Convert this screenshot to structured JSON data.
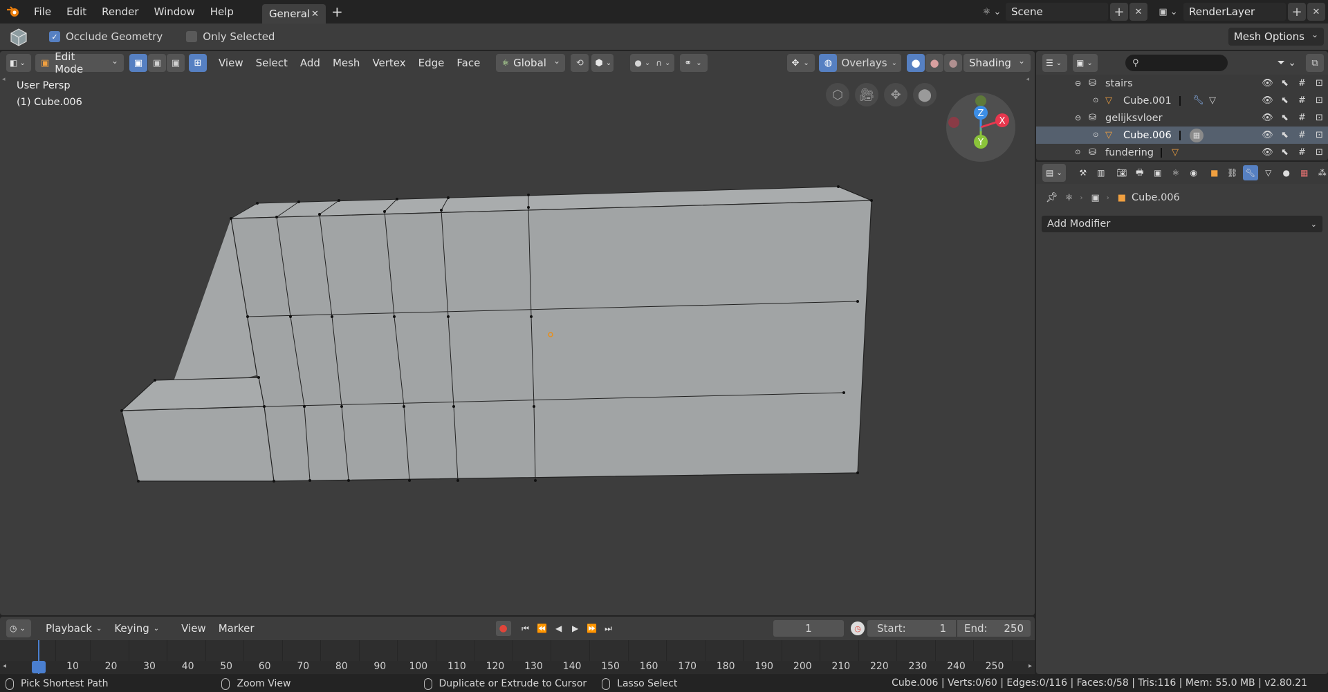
{
  "topbar": {
    "menus": [
      "File",
      "Edit",
      "Render",
      "Window",
      "Help"
    ],
    "workspace_tab": "General",
    "scene": "Scene",
    "render_layer": "RenderLayer"
  },
  "tool_header": {
    "occlude_geometry": "Occlude Geometry",
    "only_selected": "Only Selected",
    "mesh_options": "Mesh Options"
  },
  "viewport_header": {
    "mode": "Edit Mode",
    "menus": [
      "View",
      "Select",
      "Add",
      "Mesh",
      "Vertex",
      "Edge",
      "Face"
    ],
    "orientation": "Global",
    "overlays": "Overlays",
    "shading": "Shading"
  },
  "viewport": {
    "view_label": "User Persp",
    "object_label": "(1) Cube.006",
    "gizmo": {
      "z": "Z",
      "y": "Y",
      "x": "X"
    },
    "colors": {
      "x_axis": "#e8374e",
      "y_axis": "#8bc43a",
      "z_axis": "#3c8ee6"
    }
  },
  "outliner": {
    "search_placeholder": "",
    "rows": [
      {
        "name": "stairs",
        "type": "collection"
      },
      {
        "name": "Cube.001",
        "type": "mesh"
      },
      {
        "name": "gelijksvloer",
        "type": "collection"
      },
      {
        "name": "Cube.006",
        "type": "mesh",
        "selected": true
      },
      {
        "name": "fundering",
        "type": "collection"
      }
    ]
  },
  "properties": {
    "breadcrumb_object": "Cube.006",
    "add_modifier": "Add Modifier"
  },
  "timeline": {
    "menus": [
      "Playback",
      "Keying",
      "View",
      "Marker"
    ],
    "current_frame": "1",
    "start_label": "Start:",
    "start_value": "1",
    "end_label": "End:",
    "end_value": "250",
    "ticks": [
      "1",
      "10",
      "20",
      "30",
      "40",
      "50",
      "60",
      "70",
      "80",
      "90",
      "100",
      "110",
      "120",
      "130",
      "140",
      "150",
      "160",
      "170",
      "180",
      "190",
      "200",
      "210",
      "220",
      "230",
      "240",
      "250"
    ]
  },
  "statusbar": {
    "hints": [
      "Pick Shortest Path",
      "Zoom View",
      "Duplicate or Extrude to Cursor",
      "Lasso Select"
    ],
    "stats": "Cube.006 | Verts:0/60 | Edges:0/116 | Faces:0/58 | Tris:116 | Mem: 55.0 MB | v2.80.21"
  }
}
